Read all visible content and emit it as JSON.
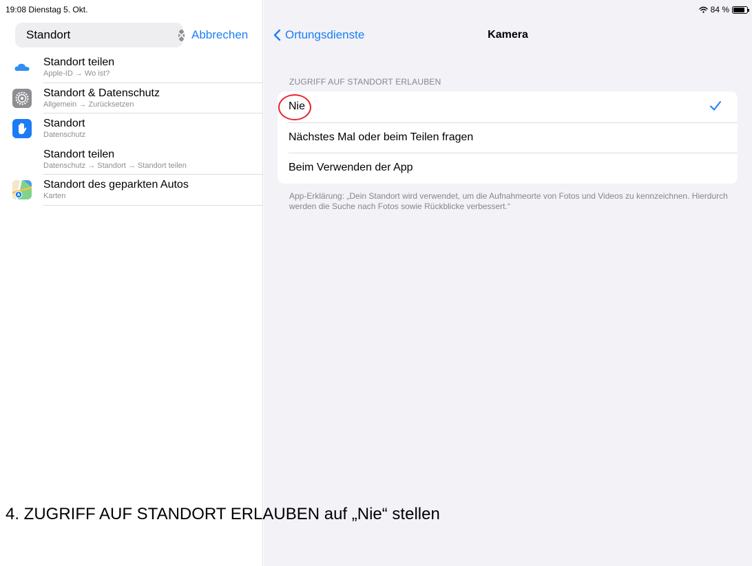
{
  "status_bar": {
    "time_date": "19:08  Dienstag 5. Okt.",
    "battery": "84 %"
  },
  "search": {
    "value": "Standort",
    "cancel_label": "Abbrechen"
  },
  "results": [
    {
      "title": "Standort teilen",
      "subtitle": "Apple-ID → Wo ist?",
      "icon": "icloud-icon"
    },
    {
      "title": "Standort & Datenschutz",
      "subtitle": "Allgemein → Zurücksetzen",
      "icon": "settings-gear-icon"
    },
    {
      "title": "Standort",
      "subtitle": "Datenschutz",
      "icon": "privacy-hand-icon"
    },
    {
      "title": "Standort teilen",
      "subtitle": "Datenschutz → Standort → Standort teilen",
      "icon": ""
    },
    {
      "title": "Standort des geparkten Autos",
      "subtitle": "Karten",
      "icon": "maps-icon"
    }
  ],
  "detail": {
    "back_label": "Ortungsdienste",
    "title": "Kamera",
    "section_header": "ZUGRIFF AUF STANDORT ERLAUBEN",
    "options": [
      {
        "label": "Nie",
        "selected": true
      },
      {
        "label": "Nächstes Mal oder beim Teilen fragen",
        "selected": false
      },
      {
        "label": "Beim Verwenden der App",
        "selected": false
      }
    ],
    "footer": "App-Erklärung: „Dein Standort wird verwendet, um die Aufnahmeorte von Fotos und Videos zu kennzeichnen. Hierdurch werden die Suche nach Fotos sowie Rückblicke verbessert.“"
  },
  "caption": "4. ZUGRIFF AUF STANDORT ERLAUBEN auf „Nie“ stellen",
  "colors": {
    "accent": "#1a7ff2",
    "highlight": "#e8252d"
  }
}
